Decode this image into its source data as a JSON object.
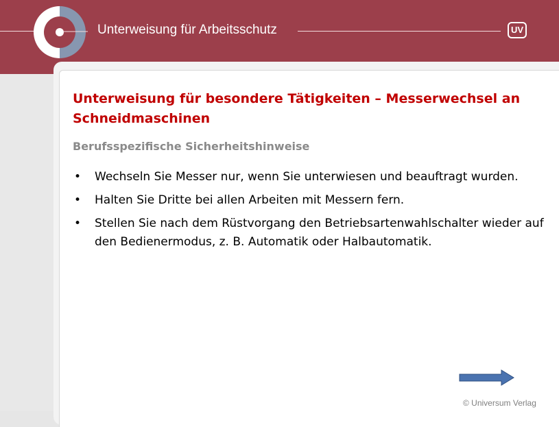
{
  "header": {
    "title": "Unterweisung für Arbeitsschutz",
    "badge": "UV",
    "brand_color": "#9c3f4b"
  },
  "slide": {
    "title": "Unterweisung für besondere Tätigkeiten – Messerwechsel an Schneidmaschinen",
    "subtitle": "Berufsspezifische Sicherheitshinweise",
    "bullet_symbol": "•",
    "bullets": [
      "Wechseln Sie Messer nur, wenn Sie unterwiesen und beauftragt wurden.",
      "Halten Sie Dritte bei allen Arbeiten mit Messern fern.",
      "Stellen Sie nach dem Rüstvorgang den Betriebsartenwahlschalter wieder auf den Bedienermodus, z. B. Automatik oder Halbautomatik."
    ],
    "title_color": "#c00000",
    "subtitle_color": "#8a8a8a"
  },
  "navigation": {
    "next_icon": "arrow-right-icon",
    "arrow_color": "#4a73b0"
  },
  "footer": {
    "copyright": "© Universum Verlag"
  }
}
